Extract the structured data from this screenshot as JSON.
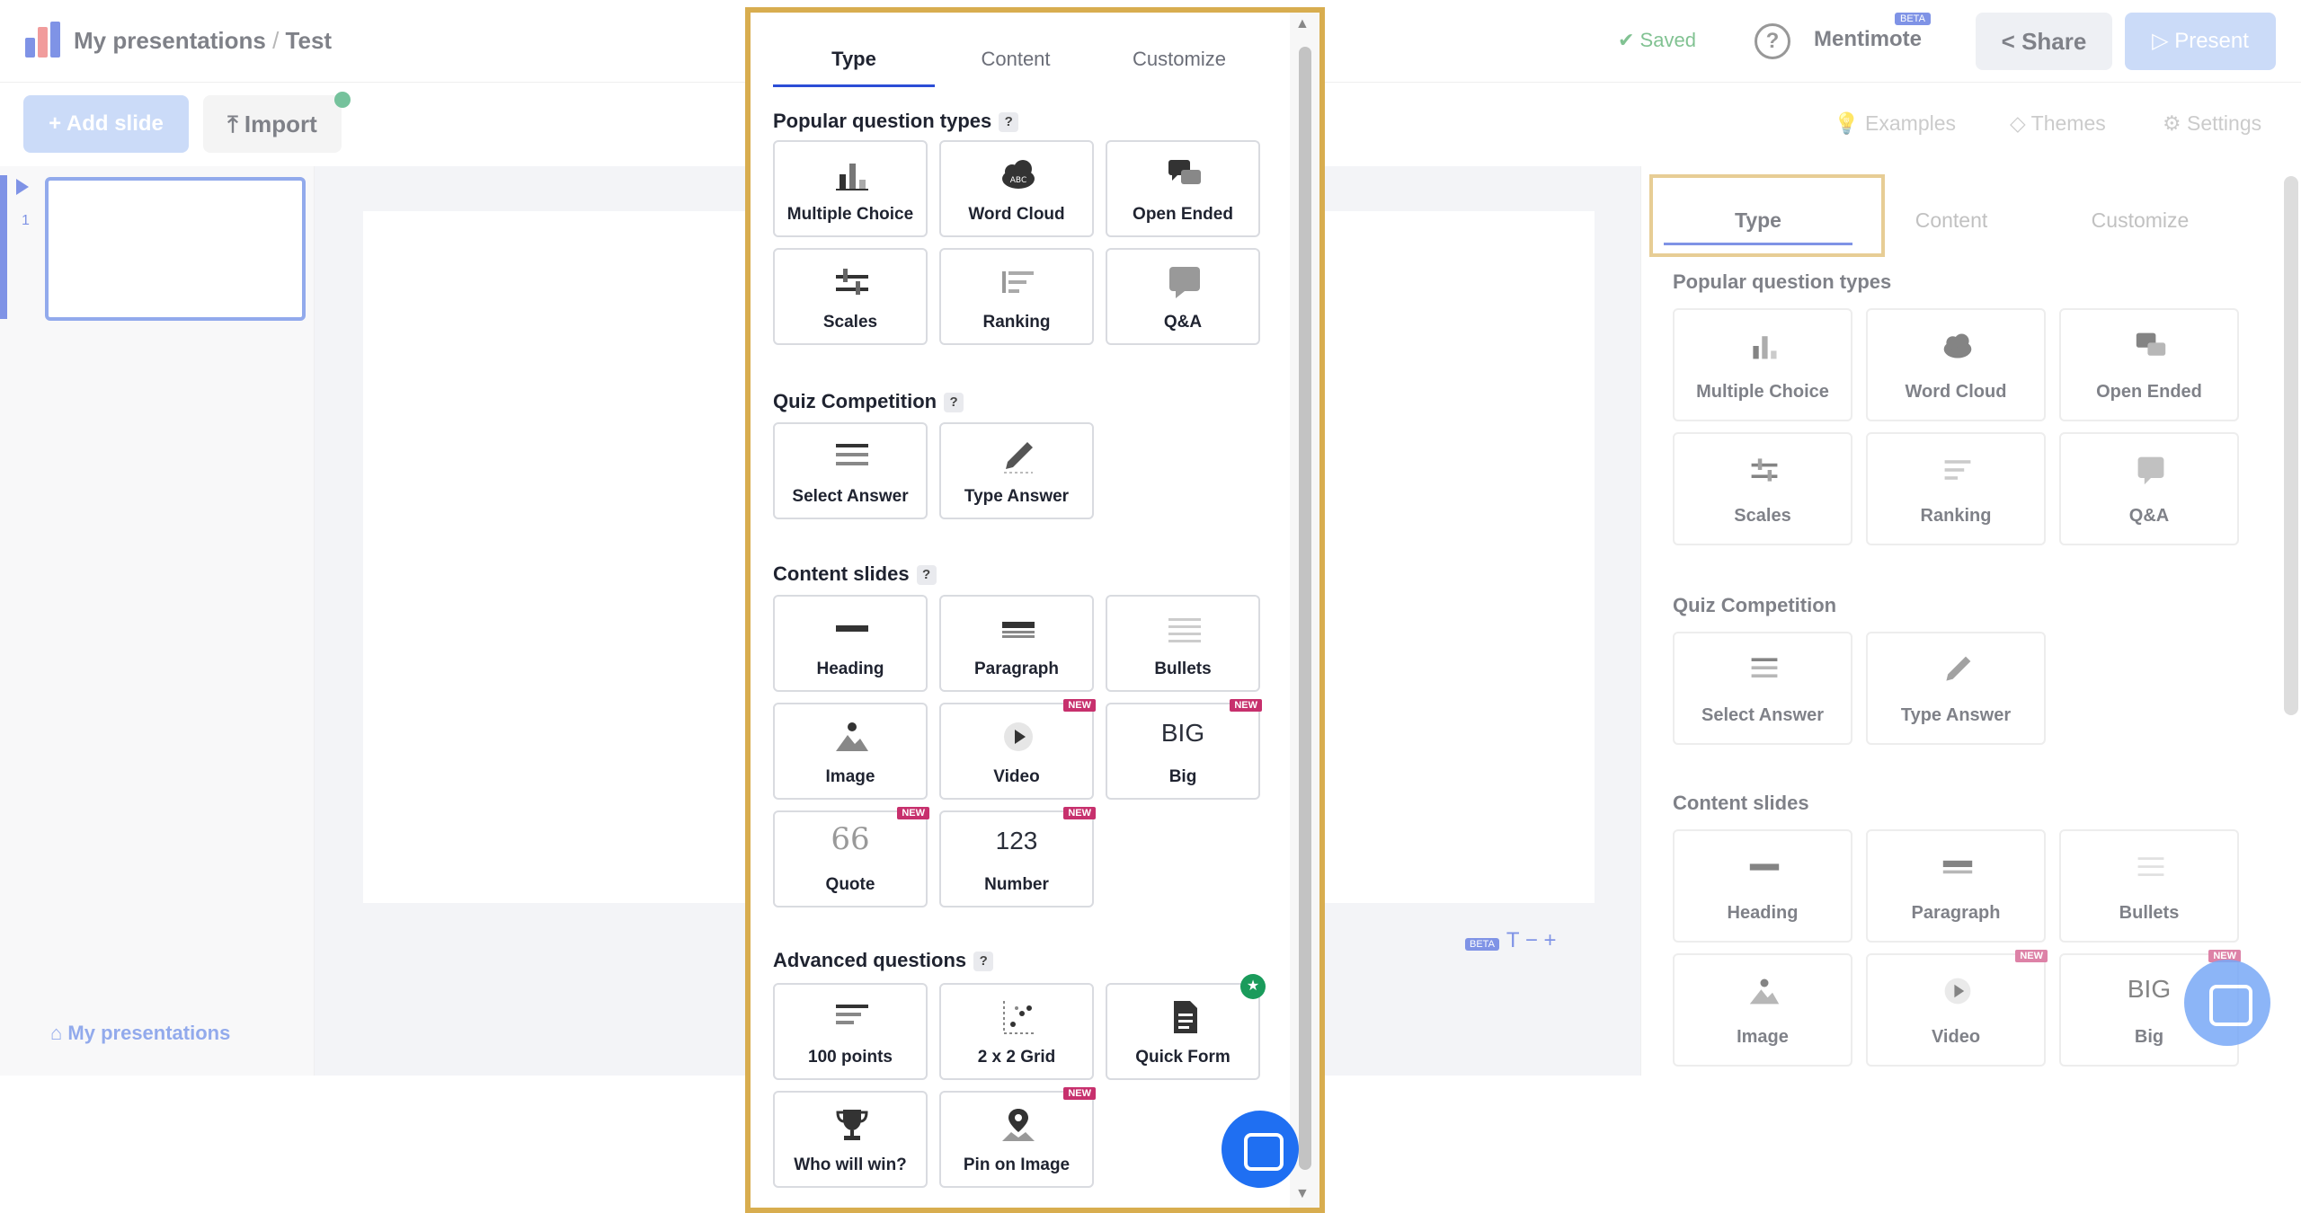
{
  "app": {
    "breadcrumb_root": "My presentations",
    "breadcrumb_sep": "/",
    "breadcrumb_current": "Test",
    "saved_label": "Saved",
    "mentimote_label": "Mentimote",
    "mentimote_badge": "BETA",
    "share_label": "Share",
    "present_label": "Present",
    "add_slide_label": "+ Add slide",
    "import_label": "Import",
    "examples_label": "Examples",
    "themes_label": "Themes",
    "settings_label": "Settings",
    "slide_number": "1",
    "my_presentations_link": "My presentations",
    "zoom_badge": "BETA",
    "zoom_controls": "T − +"
  },
  "type_panel": {
    "tabs": [
      {
        "label": "Type",
        "active": true
      },
      {
        "label": "Content",
        "active": false
      },
      {
        "label": "Customize",
        "active": false
      }
    ],
    "sections": [
      {
        "title": "Popular question types",
        "help": "?",
        "items": [
          {
            "label": "Multiple Choice",
            "icon": "bar-chart-icon"
          },
          {
            "label": "Word Cloud",
            "icon": "cloud-abc-icon",
            "icon_text": "ABC"
          },
          {
            "label": "Open Ended",
            "icon": "speech-bubbles-icon"
          },
          {
            "label": "Scales",
            "icon": "sliders-icon"
          },
          {
            "label": "Ranking",
            "icon": "ranking-lines-icon"
          },
          {
            "label": "Q&A",
            "icon": "chat-bubble-icon"
          }
        ]
      },
      {
        "title": "Quiz Competition",
        "help": "?",
        "items": [
          {
            "label": "Select Answer",
            "icon": "list-lines-icon"
          },
          {
            "label": "Type Answer",
            "icon": "pencil-icon"
          }
        ]
      },
      {
        "title": "Content slides",
        "help": "?",
        "items": [
          {
            "label": "Heading",
            "icon": "heading-bar-icon"
          },
          {
            "label": "Paragraph",
            "icon": "paragraph-icon"
          },
          {
            "label": "Bullets",
            "icon": "bullets-icon"
          },
          {
            "label": "Image",
            "icon": "image-icon"
          },
          {
            "label": "Video",
            "icon": "play-icon",
            "badge": "NEW"
          },
          {
            "label": "Big",
            "icon": "big-text-icon",
            "icon_text": "BIG",
            "badge": "NEW"
          },
          {
            "label": "Quote",
            "icon": "quote-icon",
            "icon_text": "66",
            "badge": "NEW"
          },
          {
            "label": "Number",
            "icon": "number-icon",
            "icon_text": "123",
            "badge": "NEW"
          }
        ]
      },
      {
        "title": "Advanced questions",
        "help": "?",
        "items": [
          {
            "label": "100 points",
            "icon": "hundred-points-icon"
          },
          {
            "label": "2 x 2 Grid",
            "icon": "grid-dots-icon"
          },
          {
            "label": "Quick Form",
            "icon": "document-icon",
            "badge": "★"
          },
          {
            "label": "Who will win?",
            "icon": "trophy-icon"
          },
          {
            "label": "Pin on Image",
            "icon": "pin-icon",
            "badge": "NEW"
          }
        ]
      }
    ]
  },
  "colors": {
    "accent_blue": "#2b4dd6",
    "highlight_gold": "#d8ad4f",
    "new_badge": "#c7306d",
    "star_badge": "#1a9b5b"
  }
}
